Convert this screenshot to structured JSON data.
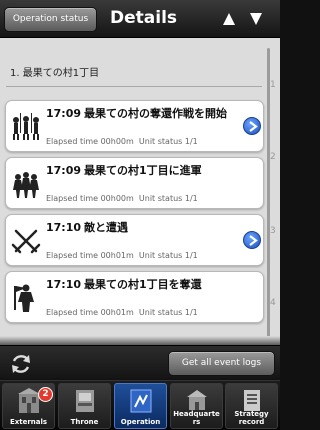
{
  "header": {
    "back_label": "Operation status",
    "title": "Details"
  },
  "section": {
    "title": "1. 最果ての村1丁目"
  },
  "events": [
    {
      "time": "17:09",
      "text": "最果ての村の奪還作戦を開始",
      "elapsed": "Elapsed time 00h00m",
      "unit_status": "Unit status 1/1",
      "has_link": true,
      "icon": "soldiers-icon"
    },
    {
      "time": "17:09",
      "text": "最果ての村1丁目に進軍",
      "elapsed": "Elapsed time 00h00m",
      "unit_status": "Unit status 1/1",
      "has_link": false,
      "icon": "march-icon"
    },
    {
      "time": "17:10",
      "text": "敵と遭遇",
      "elapsed": "Elapsed time 00h01m",
      "unit_status": "Unit status 1/1",
      "has_link": true,
      "icon": "crossed-swords-icon"
    },
    {
      "time": "17:10",
      "text": "最果ての村1丁目を奪還",
      "elapsed": "Elapsed time 00h01m",
      "unit_status": "Unit status 1/1",
      "has_link": false,
      "icon": "victory-icon"
    }
  ],
  "numbers": [
    "1",
    "2",
    "3",
    "4"
  ],
  "toolbar": {
    "get_logs_label": "Get all event logs"
  },
  "tabs": [
    {
      "label": "Externals",
      "badge": "2",
      "active": false
    },
    {
      "label": "Throne",
      "active": false
    },
    {
      "label": "Operation",
      "active": true
    },
    {
      "label": "Headquarte rs",
      "active": false
    },
    {
      "label": "Strategy record",
      "active": false
    }
  ],
  "colors": {
    "accent_blue": "#1f4f9a",
    "badge_red": "#e23b2e",
    "content_bg": "#dcdcdc"
  }
}
